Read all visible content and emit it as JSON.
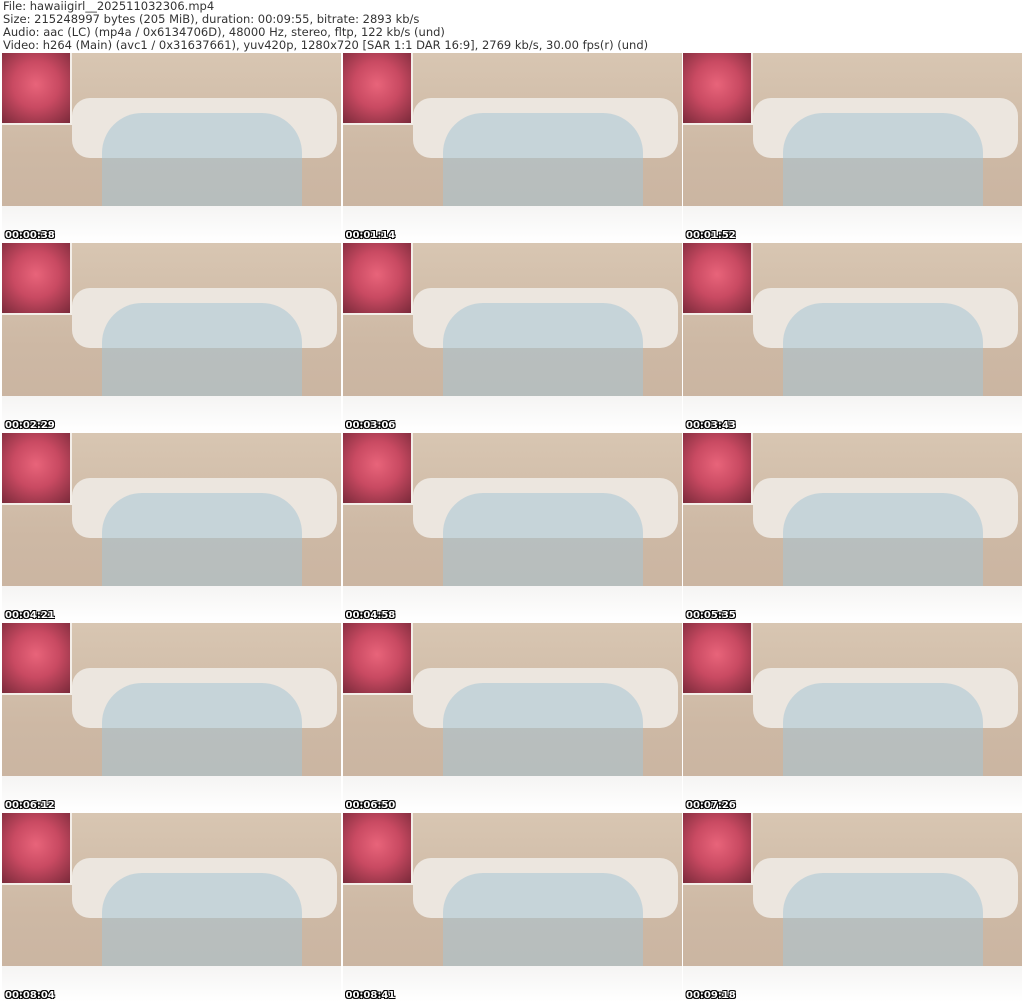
{
  "header": {
    "file": "File: hawaiigirl__202511032306.mp4",
    "size": "Size: 215248997 bytes (205 MiB), duration: 00:09:55, bitrate: 2893 kb/s",
    "audio": "Audio: aac (LC) (mp4a / 0x6134706D), 48000 Hz, stereo, fltp, 122 kb/s (und)",
    "video": "Video: h264 (Main) (avc1 / 0x31637661), yuv420p, 1280x720 [SAR 1:1 DAR 16:9], 2769 kb/s, 30.00 fps(r) (und)"
  },
  "thumbnails": [
    {
      "timestamp": "00:00:38"
    },
    {
      "timestamp": "00:01:14"
    },
    {
      "timestamp": "00:01:52"
    },
    {
      "timestamp": "00:02:29"
    },
    {
      "timestamp": "00:03:06"
    },
    {
      "timestamp": "00:03:43"
    },
    {
      "timestamp": "00:04:21"
    },
    {
      "timestamp": "00:04:58"
    },
    {
      "timestamp": "00:05:35"
    },
    {
      "timestamp": "00:06:12"
    },
    {
      "timestamp": "00:06:50"
    },
    {
      "timestamp": "00:07:26"
    },
    {
      "timestamp": "00:08:04"
    },
    {
      "timestamp": "00:08:41"
    },
    {
      "timestamp": "00:09:18"
    }
  ]
}
